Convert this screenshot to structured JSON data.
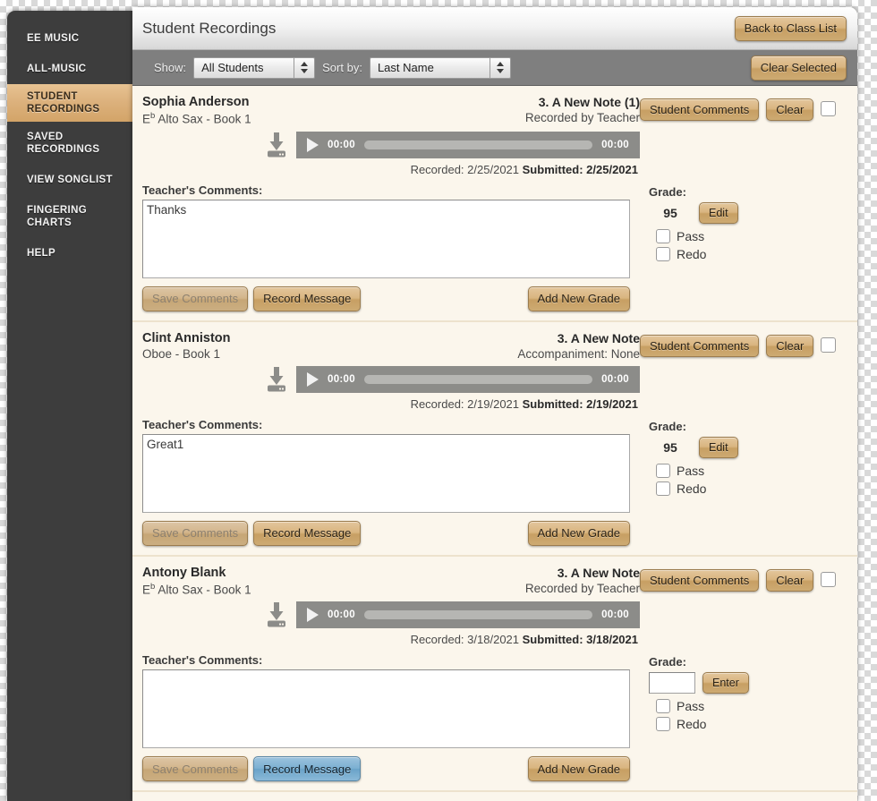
{
  "sidebar": {
    "items": [
      {
        "label": "EE MUSIC",
        "active": false
      },
      {
        "label": "ALL-MUSIC",
        "active": false
      },
      {
        "label": "STUDENT RECORDINGS",
        "active": true
      },
      {
        "label": "SAVED RECORDINGS",
        "active": false
      },
      {
        "label": "VIEW SONGLIST",
        "active": false
      },
      {
        "label": "FINGERING CHARTS",
        "active": false
      },
      {
        "label": "HELP",
        "active": false
      }
    ]
  },
  "header": {
    "title": "Student Recordings",
    "back_button": "Back to Class List"
  },
  "toolbar": {
    "show_label": "Show:",
    "show_value": "All Students",
    "sort_label": "Sort by:",
    "sort_value": "Last Name",
    "clear_selected": "Clear Selected"
  },
  "labels": {
    "teacher_comments": "Teacher's Comments:",
    "grade": "Grade:",
    "pass": "Pass",
    "redo": "Redo",
    "student_comments": "Student Comments",
    "clear": "Clear",
    "save_comments": "Save Comments",
    "record_message": "Record Message",
    "add_new_grade": "Add New Grade",
    "edit": "Edit",
    "enter": "Enter",
    "recorded_prefix": "Recorded:",
    "submitted_prefix": "Submitted:"
  },
  "records": [
    {
      "student_name": "Sophia Anderson",
      "instrument": "E♭ Alto Sax - Book 1",
      "instrument_key": "E",
      "instrument_accidental": "b",
      "instrument_rest": " Alto Sax - Book 1",
      "piece_title": "3. A New Note (1)",
      "piece_subtitle": "Recorded by Teacher",
      "time_current": "00:00",
      "time_total": "00:00",
      "recorded_date": "2/25/2021",
      "submitted_date": "2/25/2021",
      "comment_text": "Thanks",
      "grade_mode": "value",
      "grade_value": "95",
      "grade_button": "Edit",
      "pass_checked": false,
      "redo_checked": false,
      "selected": false,
      "save_disabled": true,
      "record_active": false
    },
    {
      "student_name": "Clint Anniston",
      "instrument": "Oboe - Book 1",
      "instrument_key": "",
      "instrument_accidental": "",
      "instrument_rest": "Oboe - Book 1",
      "piece_title": "3. A New Note",
      "piece_subtitle": "Accompaniment: None",
      "time_current": "00:00",
      "time_total": "00:00",
      "recorded_date": "2/19/2021",
      "submitted_date": "2/19/2021",
      "comment_text": "Great1",
      "grade_mode": "value",
      "grade_value": "95",
      "grade_button": "Edit",
      "pass_checked": false,
      "redo_checked": false,
      "selected": false,
      "save_disabled": true,
      "record_active": false
    },
    {
      "student_name": "Antony Blank",
      "instrument": "E♭ Alto Sax - Book 1",
      "instrument_key": "E",
      "instrument_accidental": "b",
      "instrument_rest": " Alto Sax - Book 1",
      "piece_title": "3. A New Note",
      "piece_subtitle": "Recorded by Teacher",
      "time_current": "00:00",
      "time_total": "00:00",
      "recorded_date": "3/18/2021",
      "submitted_date": "3/18/2021",
      "comment_text": "",
      "grade_mode": "input",
      "grade_value": "",
      "grade_button": "Enter",
      "pass_checked": false,
      "redo_checked": false,
      "selected": false,
      "save_disabled": true,
      "record_active": true
    }
  ],
  "colors": {
    "accent_tan": "#d9b580",
    "sidebar_bg": "#3d3d3d",
    "panel_bg": "#fbf6ec",
    "toolbar_bg": "#7f7f7f",
    "player_bg": "#8c8c89",
    "active_blue": "#7bb0d2"
  }
}
